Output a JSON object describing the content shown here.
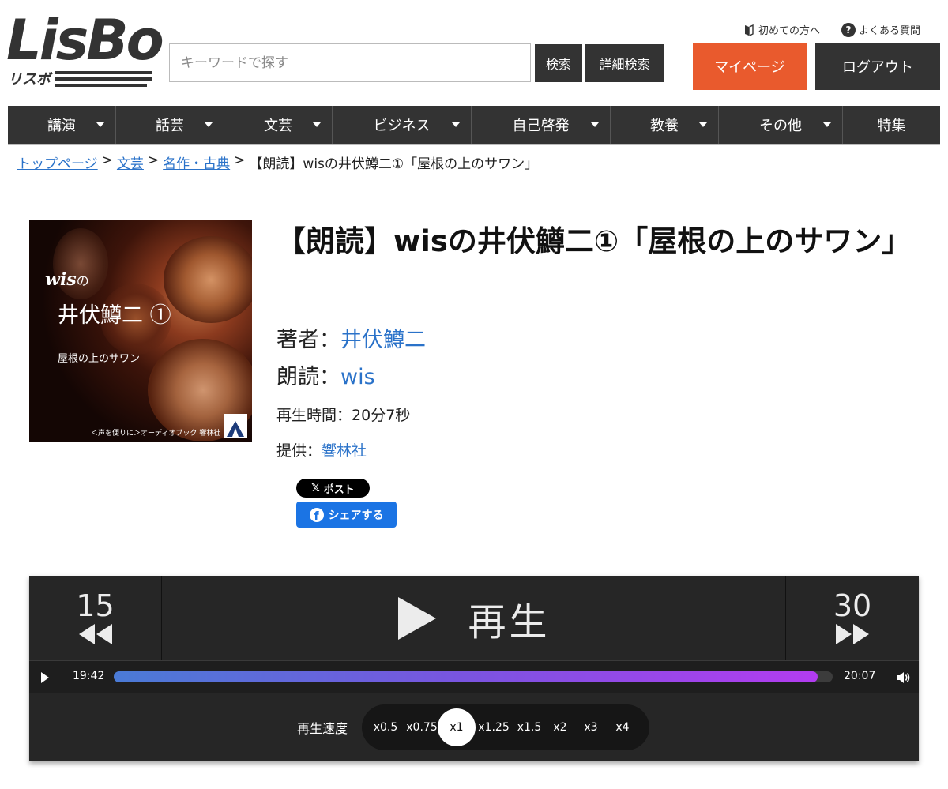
{
  "brand": {
    "logo": "LisBo",
    "logo_sub": "リスボ"
  },
  "header": {
    "search_placeholder": "キーワードで探す",
    "search_button": "検索",
    "advanced_search_button": "詳細検索",
    "mypage_button": "マイページ",
    "logout_button": "ログアウト",
    "first_time_link": "初めての方へ",
    "faq_link": "よくある質問",
    "faq_icon_glyph": "?"
  },
  "nav": [
    {
      "label": "講演",
      "dropdown": true
    },
    {
      "label": "話芸",
      "dropdown": true
    },
    {
      "label": "文芸",
      "dropdown": true
    },
    {
      "label": "ビジネス",
      "dropdown": true
    },
    {
      "label": "自己啓発",
      "dropdown": true
    },
    {
      "label": "教養",
      "dropdown": true
    },
    {
      "label": "その他",
      "dropdown": true
    },
    {
      "label": "特集",
      "dropdown": false
    }
  ],
  "breadcrumb": {
    "items": [
      "トップページ",
      "文芸",
      "名作・古典"
    ],
    "separator": ">",
    "current": "【朗読】wisの井伏鱒二①「屋根の上のサワン」"
  },
  "cover": {
    "line1": "wis",
    "line1_suffix": "の",
    "line2": "井伏鱒二 ①",
    "line3": "屋根の上のサワン",
    "publisher_line": "＜声を便りに＞オーディオブック 響林社"
  },
  "product": {
    "title": "【朗読】wisの井伏鱒二①「屋根の上のサワン」",
    "author_label": "著者：",
    "author": "井伏鱒二",
    "reader_label": "朗読：",
    "reader": "wis",
    "duration_label": "再生時間：",
    "duration": "20分7秒",
    "provider_label": "提供：",
    "provider": "響林社"
  },
  "share": {
    "x_label": "ポスト",
    "x_glyph": "𝕏",
    "fb_label": "シェアする",
    "fb_glyph": "f"
  },
  "player": {
    "rewind_seconds": "15",
    "forward_seconds": "30",
    "play_label": "再生",
    "current_time": "19:42",
    "total_time": "20:07",
    "progress_fraction": 0.979,
    "speed_label": "再生速度",
    "speeds": [
      "x0.5",
      "x0.75",
      "x1",
      "x1.25",
      "x1.5",
      "x2",
      "x3",
      "x4"
    ],
    "selected_speed": "x1"
  },
  "colors": {
    "accent": "#e95a2d",
    "dark": "#333333",
    "link": "#2a72c9",
    "facebook": "#1b74e4"
  }
}
